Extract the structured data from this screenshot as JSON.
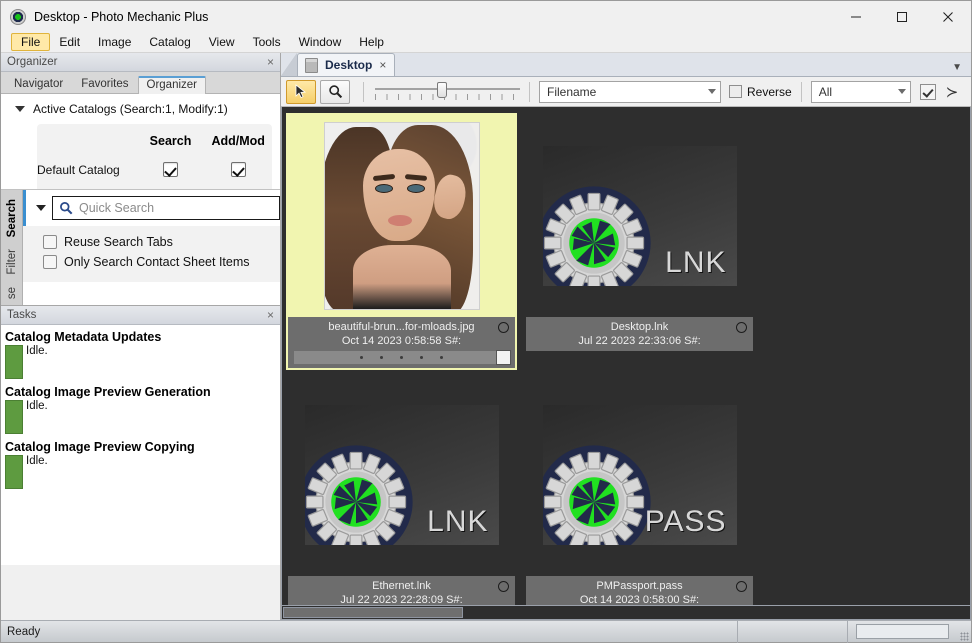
{
  "window": {
    "title": "Desktop - Photo Mechanic Plus",
    "app_icon": "aperture-gear-icon",
    "minimize_label": "Minimize",
    "maximize_label": "Maximize",
    "close_label": "Close"
  },
  "menubar": {
    "items": [
      {
        "label": "File",
        "active": true
      },
      {
        "label": "Edit",
        "active": false
      },
      {
        "label": "Image",
        "active": false
      },
      {
        "label": "Catalog",
        "active": false
      },
      {
        "label": "View",
        "active": false
      },
      {
        "label": "Tools",
        "active": false
      },
      {
        "label": "Window",
        "active": false
      },
      {
        "label": "Help",
        "active": false
      }
    ]
  },
  "organizer": {
    "panel_title": "Organizer",
    "close_label": "×",
    "tabs": [
      {
        "label": "Navigator",
        "active": false
      },
      {
        "label": "Favorites",
        "active": false
      },
      {
        "label": "Organizer",
        "active": true
      }
    ],
    "disclosure_label": "Active Catalogs (Search:1, Modify:1)",
    "columns": [
      "",
      "Search",
      "Add/Mod"
    ],
    "rows": [
      {
        "name": "Default Catalog",
        "search": true,
        "add_mod": true
      }
    ]
  },
  "search": {
    "vertical_tabs": [
      {
        "label": "Search",
        "active": true
      },
      {
        "label": "Filter",
        "active": false
      },
      {
        "label": "se",
        "active": false
      }
    ],
    "quick_search_placeholder": "Quick Search",
    "quick_search_value": "",
    "search_icon": "magnifier-icon",
    "options": [
      {
        "label": "Reuse Search Tabs",
        "checked": false
      },
      {
        "label": "Only Search Contact Sheet Items",
        "checked": false
      }
    ]
  },
  "tasks": {
    "panel_title": "Tasks",
    "close_label": "×",
    "items": [
      {
        "title": "Catalog Metadata Updates",
        "status": "Idle.",
        "bar_color": "#5e9b40"
      },
      {
        "title": "Catalog Image Preview Generation",
        "status": "Idle.",
        "bar_color": "#5e9b40"
      },
      {
        "title": "Catalog Image Preview Copying",
        "status": "Idle.",
        "bar_color": "#5e9b40"
      }
    ]
  },
  "contact_sheet": {
    "tab": {
      "label": "Desktop",
      "close_label": "×",
      "icon": "folder-icon"
    },
    "tabstrip_chevron": "▼",
    "toolbar": {
      "pointer_tool": {
        "name": "arrow-tool",
        "selected": true
      },
      "zoom_tool": {
        "name": "magnifier-tool",
        "selected": false
      },
      "zoom_slider_value": 43,
      "sort_field": "Filename",
      "reverse_label": "Reverse",
      "reverse_checked": false,
      "filter_value": "All",
      "filter_checkbox_checked": true,
      "more_label": "≻"
    },
    "items": [
      {
        "filename": "beautiful-brun...for-mloads.jpg",
        "meta": "Oct 14 2023 0:58:58 S#:",
        "kind": "photo",
        "selected": true,
        "has_rating_bar": true,
        "rating_dots": 5
      },
      {
        "filename": "Desktop.lnk",
        "meta": "Jul 22 2023 22:33:06 S#:",
        "kind": "tile",
        "tile_label": "LNK",
        "selected": false,
        "has_rating_bar": false
      },
      {
        "filename": "Ethernet.lnk",
        "meta": "Jul 22 2023 22:28:09 S#:",
        "kind": "tile",
        "tile_label": "LNK",
        "selected": false,
        "has_rating_bar": false
      },
      {
        "filename": "PMPassport.pass",
        "meta": "Oct 14 2023 0:58:00 S#:",
        "kind": "tile",
        "tile_label": "PASS",
        "selected": false,
        "has_rating_bar": false
      }
    ]
  },
  "statusbar": {
    "message": "Ready"
  },
  "colors": {
    "accent_selection": "#f1f5b0",
    "menu_highlight": "#ffe9a8",
    "tool_selected": "#f5cf6a",
    "sheet_background": "#2e2e2e",
    "caption_background": "#6d6d6d",
    "task_bar_green": "#5e9b40",
    "tab_accent_blue": "#3a8fd0"
  }
}
